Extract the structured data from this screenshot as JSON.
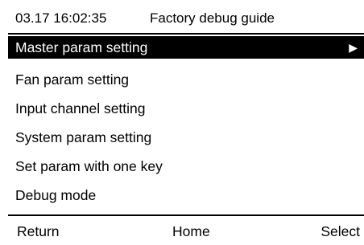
{
  "header": {
    "datetime": "03.17 16:02:35",
    "title": "Factory debug guide"
  },
  "menu": {
    "items": [
      {
        "label": "Master param setting",
        "selected": true,
        "arrow": "▶"
      },
      {
        "label": "Fan param setting",
        "selected": false
      },
      {
        "label": "Input channel setting",
        "selected": false
      },
      {
        "label": "System param setting",
        "selected": false
      },
      {
        "label": "Set param with one key",
        "selected": false
      },
      {
        "label": "Debug mode",
        "selected": false
      }
    ]
  },
  "footer": {
    "return_label": "Return",
    "home_label": "Home",
    "select_label": "Select"
  },
  "colors": {
    "background": "#ffffff",
    "text": "#000000",
    "selection_bg": "#000000",
    "selection_text": "#ffffff"
  }
}
